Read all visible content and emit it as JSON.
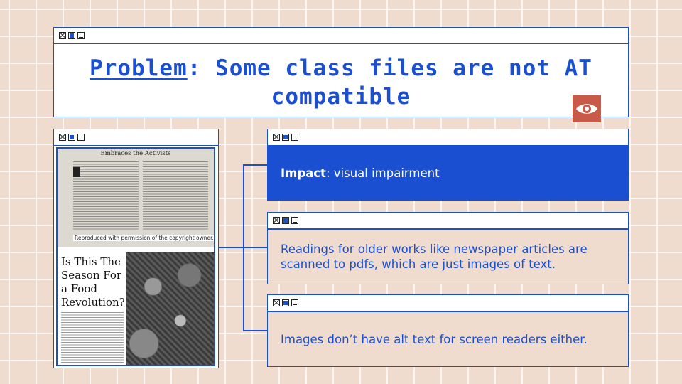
{
  "title": {
    "prefix": "Problem",
    "rest": ": Some class files are not AT compatible"
  },
  "newspaper": {
    "headline": "Embraces the Activists",
    "credit": "Reproduced with permission of the copyright owner.  Further repr",
    "headline2": "Is This The Season For a Food Revolution?"
  },
  "panels": [
    {
      "bold": "Impact",
      "text": ": visual impairment"
    },
    {
      "text": "Readings for older works like newspaper articles are scanned to pdfs, which are just images of text."
    },
    {
      "text": "Images don’t have alt text for screen readers either."
    }
  ],
  "colors": {
    "accent": "#1a4fd1",
    "background": "#efdccf",
    "eye_button": "#c85a48"
  },
  "icons": [
    "close-icon",
    "maximize-icon",
    "minimize-icon",
    "eye-icon"
  ]
}
